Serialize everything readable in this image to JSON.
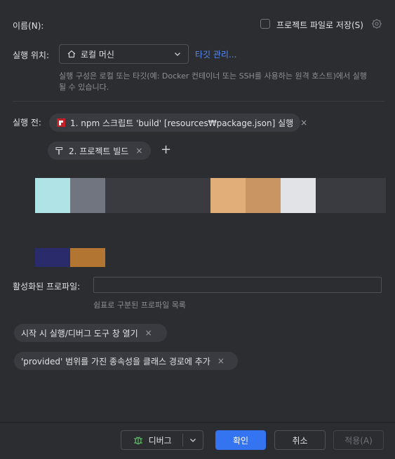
{
  "name_label": "이름(N):",
  "save_to_project_file": "프로젝트 파일로 저장(S)",
  "run_location": {
    "label": "실행 위치:",
    "selected": "로컬 머신",
    "manage_targets": "타깃 관리...",
    "hint_line1": "실행 구성은 로컬 또는 타깃(예: Docker 컨테이너 또는 SSH를 사용하는 원격 호스트)에서 실행",
    "hint_line2": "될 수 있습니다."
  },
  "before_run": {
    "label": "실행 전:",
    "tasks": [
      {
        "label": "1. npm 스크립트 'build' [resources₩package.json] 실행",
        "icon": "npm-icon"
      },
      {
        "label": "2. 프로젝트 빌드",
        "icon": "hammer-icon"
      }
    ],
    "add_symbol": "+",
    "remove_symbol": "×"
  },
  "color_swatches_row1": [
    "#afe3e6",
    "#707580",
    "#393b40",
    "#393b40",
    "#393b40",
    "#e1ad79",
    "#c99663",
    "#e2e3e6",
    "#393b40",
    "#393b40"
  ],
  "color_swatches_row2": [
    "#2a2b6b",
    "#b37532"
  ],
  "active_profiles": {
    "label": "활성화된 프로파일:",
    "value": "",
    "hint": "쉼표로 구분된 프로파일 목록"
  },
  "options": [
    "시작 시 실행/디버그 도구 창 열기",
    "'provided' 범위를 가진 종속성을 클래스 경로에 추가"
  ],
  "footer": {
    "debug": "디버그",
    "ok": "확인",
    "cancel": "취소",
    "apply": "적용(A)"
  }
}
